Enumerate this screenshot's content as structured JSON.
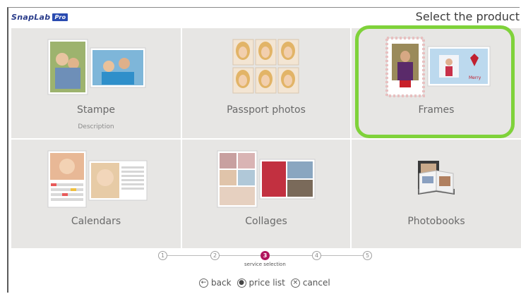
{
  "header": {
    "logo_text": "SnapLab",
    "logo_badge": "Pro",
    "title": "Select the product"
  },
  "products": [
    {
      "label": "Stampe",
      "description": "Description",
      "icon": "photo-prints-icon"
    },
    {
      "label": "Passport photos",
      "description": "",
      "icon": "passport-photos-icon"
    },
    {
      "label": "Frames",
      "description": "",
      "icon": "frames-icon",
      "highlighted": true
    },
    {
      "label": "Calendars",
      "description": "",
      "icon": "calendars-icon"
    },
    {
      "label": "Collages",
      "description": "",
      "icon": "collages-icon"
    },
    {
      "label": "Photobooks",
      "description": "",
      "icon": "photobooks-icon"
    }
  ],
  "stepper": {
    "steps": [
      "1",
      "2",
      "3",
      "4",
      "5"
    ],
    "active_step": 3,
    "active_caption": "service selection"
  },
  "nav": {
    "back": "back",
    "price_list": "price list",
    "cancel": "cancel"
  },
  "colors": {
    "tile_bg": "#e7e6e4",
    "highlight": "#7fd23a",
    "active_step": "#b0145c",
    "logo": "#2a3c8a"
  }
}
